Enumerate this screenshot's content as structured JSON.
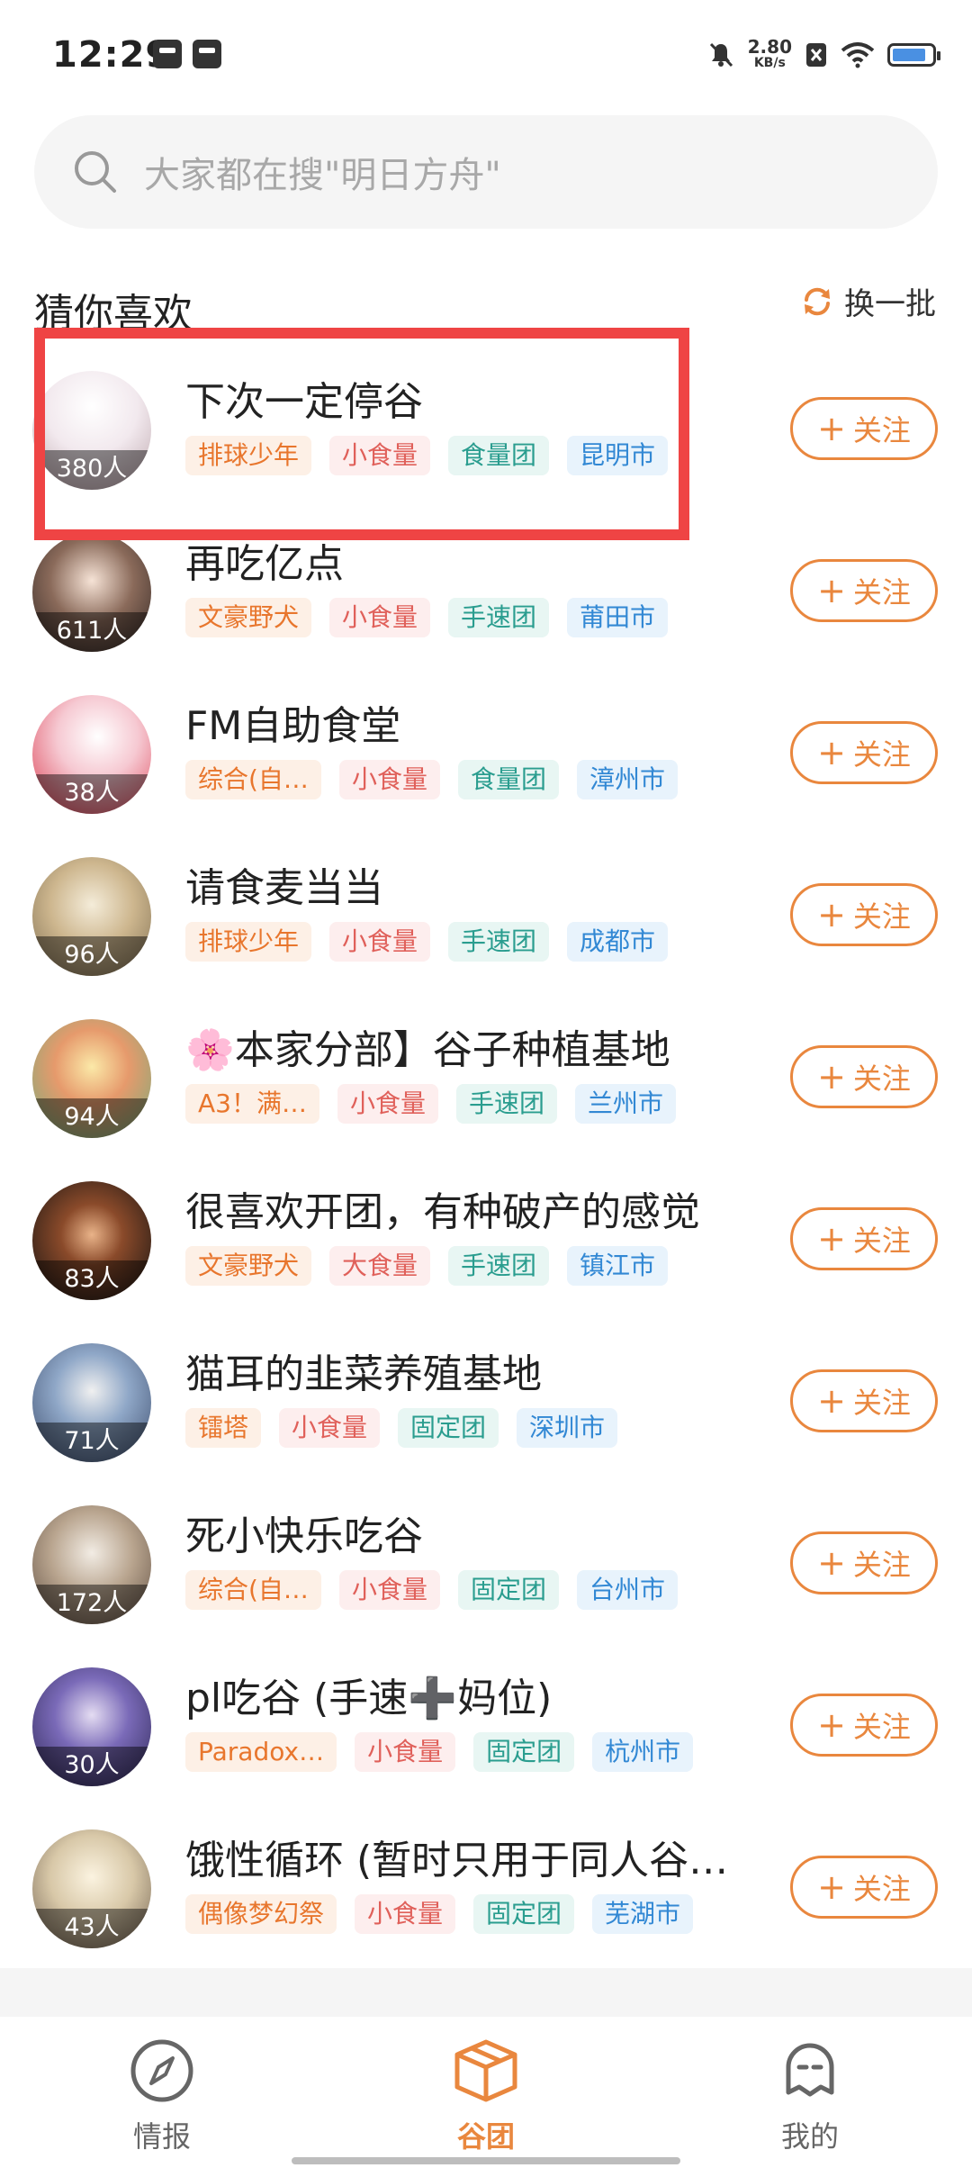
{
  "status_bar": {
    "time": "12:29",
    "net_speed": "2.80",
    "net_unit": "KB/s"
  },
  "search": {
    "placeholder": "大家都在搜\"明日方舟\""
  },
  "section": {
    "title": "猜你喜欢",
    "refresh_label": "换一批"
  },
  "follow_label": "关注",
  "groups": [
    {
      "name": "下次一定停谷",
      "members": "380人",
      "tags": [
        "排球少年",
        "小食量",
        "食量团",
        "昆明市"
      ]
    },
    {
      "name": "再吃亿点",
      "members": "611人",
      "tags": [
        "文豪野犬",
        "小食量",
        "手速团",
        "莆田市"
      ]
    },
    {
      "name": "FM自助食堂",
      "members": "38人",
      "tags": [
        "综合(自…",
        "小食量",
        "食量团",
        "漳州市"
      ]
    },
    {
      "name": "请食麦当当",
      "members": "96人",
      "tags": [
        "排球少年",
        "小食量",
        "手速团",
        "成都市"
      ]
    },
    {
      "name": "🌸本家分部】谷子种植基地",
      "members": "94人",
      "tags": [
        "A3！满…",
        "小食量",
        "手速团",
        "兰州市"
      ]
    },
    {
      "name": "很喜欢开团，有种破产的感觉",
      "members": "83人",
      "tags": [
        "文豪野犬",
        "大食量",
        "手速团",
        "镇江市"
      ]
    },
    {
      "name": "猫耳的韭菜养殖基地",
      "members": "71人",
      "tags": [
        "镭塔",
        "小食量",
        "固定团",
        "深圳市"
      ]
    },
    {
      "name": "死小快乐吃谷",
      "members": "172人",
      "tags": [
        "综合(自…",
        "小食量",
        "固定团",
        "台州市"
      ]
    },
    {
      "name": "pl吃谷 (手速➕妈位)",
      "members": "30人",
      "tags": [
        "Paradox…",
        "小食量",
        "固定团",
        "杭州市"
      ]
    },
    {
      "name": "饿性循环 (暂时只用于同人谷…",
      "members": "43人",
      "tags": [
        "偶像梦幻祭",
        "小食量",
        "固定团",
        "芜湖市"
      ]
    }
  ],
  "bottom_nav": [
    {
      "label": "情报",
      "icon": "compass-icon"
    },
    {
      "label": "谷团",
      "icon": "box-icon",
      "active": true
    },
    {
      "label": "我的",
      "icon": "profile-icon"
    }
  ],
  "colors": {
    "accent": "#e9873e",
    "highlight": "#ef4444"
  }
}
